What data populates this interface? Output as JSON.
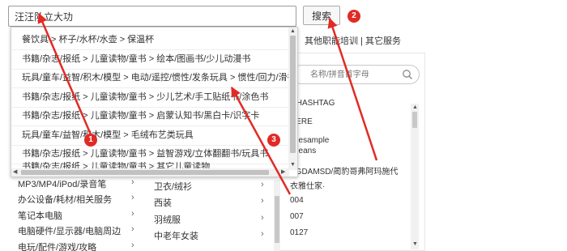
{
  "search": {
    "value": "汪汪队立大功",
    "button_label": "搜索"
  },
  "top_nav": {
    "text": "其他职能培训 | 其它服务",
    "separator": "|"
  },
  "suggestions": [
    "餐饮具 > 杯子/水杯/水壶 > 保温杯",
    "书籍/杂志/报纸 > 儿童读物/童书 > 绘本/图画书/少儿动漫书",
    "玩具/童车/益智/积木/模型 > 电动/遥控/惯性/发条玩具 > 惯性/回力/滑行玩具",
    "书籍/杂志/报纸 > 儿童读物/童书 > 少儿艺术/手工贴纸书/涂色书",
    "书籍/杂志/报纸 > 儿童读物/童书 > 启蒙认知书/黑白卡/识字卡",
    "玩具/童车/益智/积木/模型 > 毛绒布艺类玩具",
    "书籍/杂志/报纸 > 儿童读物/童书 > 益智游戏/立体翻翻书/玩具书",
    "书籍/杂志/报纸 > 儿童读物/童书 > 其它儿童读物"
  ],
  "brand_filter": {
    "placeholder": "名称/拼音首字母",
    "items": [
      "OHASHTAG",
      "HERE",
      "mlesample",
      "g jeans",
      "YGDAMSD/蔺豹哥弗阿玛施代",
      "衣雅仕家·",
      "004",
      "007",
      "0127"
    ]
  },
  "left_categories": [
    "MP3/MP4/iPod/录音笔",
    "办公设备/耗材/相关服务",
    "笔记本电脑",
    "电脑硬件/显示器/电脑周边",
    "电玩/配件/游戏/攻略"
  ],
  "mid_categories": [
    "卫衣/绒衫",
    "西装",
    "羽绒服",
    "中老年女装"
  ],
  "badges": [
    "1",
    "2",
    "3"
  ],
  "colors": {
    "annotation": "#e12b25",
    "scrollbar_thumb": "#c1c1c1"
  }
}
